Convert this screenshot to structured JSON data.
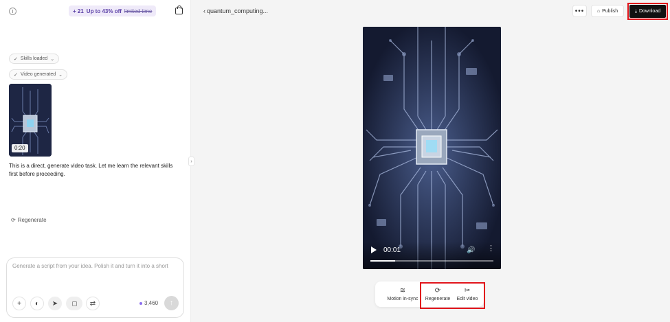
{
  "header": {
    "promo_count": "+ 21",
    "promo_text": "Up to 43% off",
    "promo_strike": "limited time",
    "project_title": "quantum_computing..."
  },
  "left_panel": {
    "chips": [
      {
        "label": "Skills loaded"
      },
      {
        "label": "Video generated"
      }
    ],
    "thumbnail_duration": "0:20",
    "message": "This is a direct, generate video task. Let me learn the relevant skills first before proceeding.",
    "regenerate_label": "Regenerate",
    "composer": {
      "placeholder": "Generate a script from your idea. Polish it and turn it into a short",
      "credits": "3,460"
    }
  },
  "toolbar": {
    "more_label": "•••",
    "publish_label": "Publish",
    "download_label": "Download"
  },
  "video": {
    "current_time": "00:01",
    "progress": 0.2
  },
  "actions": [
    {
      "label": "Motion in-sync",
      "icon": "motion-icon"
    },
    {
      "label": "Regenerate",
      "icon": "regenerate-icon"
    },
    {
      "label": "Edit video",
      "icon": "edit-video-icon"
    }
  ],
  "colors": {
    "highlight": "#e1141b",
    "accent": "#5a3fa6"
  }
}
